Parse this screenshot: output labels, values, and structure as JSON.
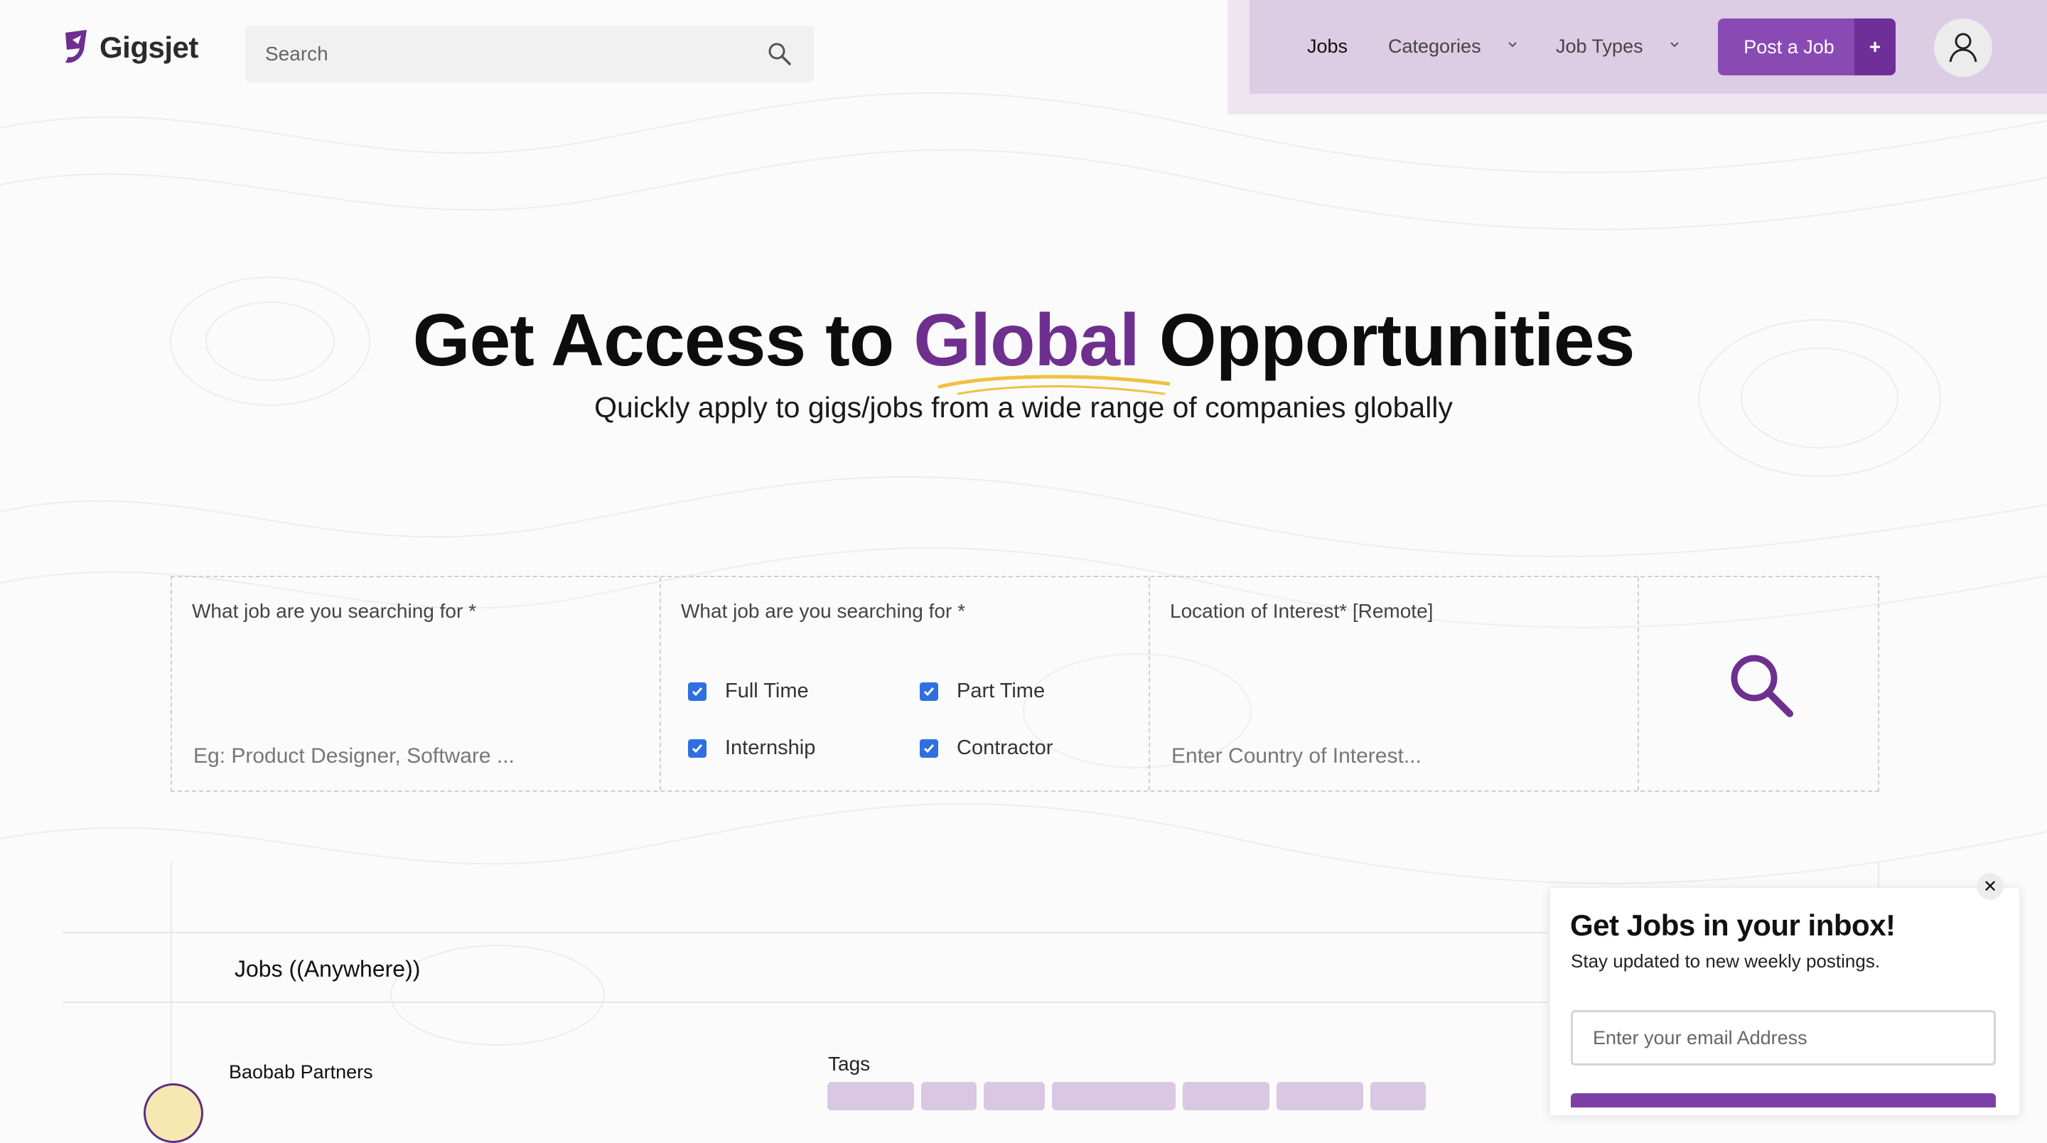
{
  "brand": {
    "name": "Gigsjet",
    "accent": "#8a4ab3",
    "accent_dark": "#6e2f8f"
  },
  "header": {
    "search_placeholder": "Search",
    "nav": {
      "jobs": "Jobs",
      "categories": "Categories",
      "job_types": "Job Types"
    },
    "post_job": {
      "label": "Post a Job",
      "plus": "+"
    }
  },
  "hero": {
    "title_pre": "Get Access to ",
    "title_accent": "Global",
    "title_post": " Opportunities",
    "subtitle": "Quickly apply to gigs/jobs from a wide range of companies globally"
  },
  "search_form": {
    "job_label": "What job are you searching for *",
    "job_placeholder": "Eg: Product Designer, Software ...",
    "type_label": "What job are you searching for *",
    "types": [
      {
        "label": "Full Time",
        "checked": true
      },
      {
        "label": "Part Time",
        "checked": true
      },
      {
        "label": "Internship",
        "checked": true
      },
      {
        "label": "Contractor",
        "checked": true
      }
    ],
    "location_label": "Location of Interest* [Remote]",
    "location_placeholder": "Enter Country of Interest..."
  },
  "jobs": {
    "heading": "Jobs ((Anywhere))",
    "first_company": "Baobab Partners",
    "tags_label": "Tags"
  },
  "newsletter": {
    "title": "Get Jobs in your inbox!",
    "subtitle": "Stay updated to new weekly postings.",
    "email_placeholder": "Enter your email Address",
    "close": "✕"
  }
}
